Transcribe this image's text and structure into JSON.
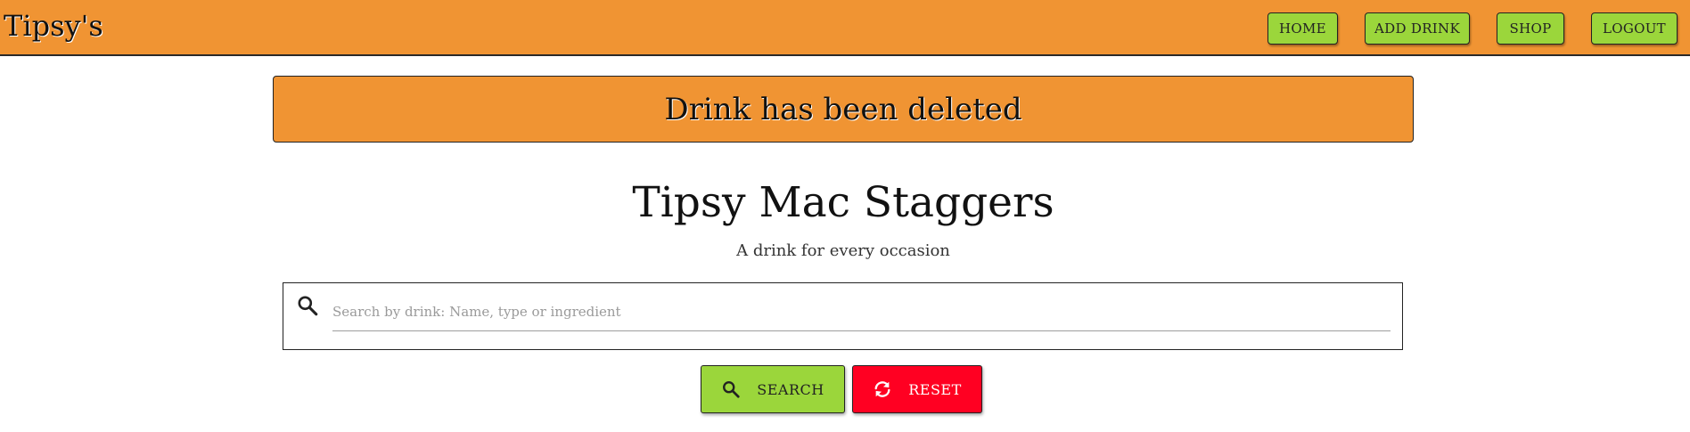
{
  "navbar": {
    "brand": "Tipsy's",
    "links": {
      "home": "HOME",
      "add_drink": "ADD DRINK",
      "shop": "SHOP",
      "logout": "LOGOUT"
    }
  },
  "alert": {
    "message": "Drink has been deleted"
  },
  "hero": {
    "title": "Tipsy Mac Staggers",
    "subtitle": "A drink for every occasion"
  },
  "search": {
    "placeholder": "Search by drink: Name, type or ingredient",
    "value": "",
    "search_label": "SEARCH",
    "reset_label": "RESET"
  },
  "icons": {
    "search": "search-icon",
    "reset": "sync-icon"
  },
  "colors": {
    "navbar_bg": "#f09433",
    "button_green": "#9bd63b",
    "reset_red": "#ff0022",
    "alert_bg": "#f09433"
  }
}
